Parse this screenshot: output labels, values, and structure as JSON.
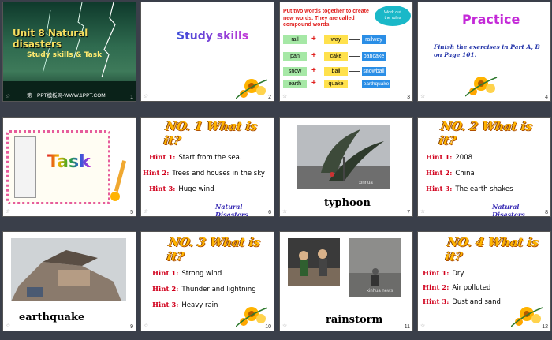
{
  "slides": [
    {
      "number": "1",
      "title": "Unit 8 Natural disasters",
      "subtitle": "Study skills & Task",
      "footer": "第一PPT模板网-WWW.1PPT.COM"
    },
    {
      "number": "2",
      "title": "Study skills"
    },
    {
      "number": "3",
      "instruction": "Put two words together to create new words. They are called compound words.",
      "bubble": "Work out the rules",
      "rows": [
        {
          "a": "rail",
          "b": "way",
          "result": "railway"
        },
        {
          "a": "pan",
          "b": "cake",
          "result": "pancake"
        },
        {
          "a": "snow",
          "b": "ball",
          "result": "snowball"
        },
        {
          "a": "earth",
          "b": "quake",
          "result": "earthquake"
        }
      ],
      "plus": "+",
      "arrow": "→"
    },
    {
      "number": "4",
      "title": "Practice",
      "body": "Finish the exercises in Part A, B on Page 101."
    },
    {
      "number": "5",
      "title": "Task"
    },
    {
      "number": "6",
      "title": "NO. 1 What is it?",
      "hints": [
        {
          "label": "Hint 1:",
          "text": "Start from the sea."
        },
        {
          "label": "Hint 2:",
          "text": "Trees and houses in the sky"
        },
        {
          "label": "Hint 3:",
          "text": "Huge wind"
        }
      ],
      "banner": "Natural Disasters"
    },
    {
      "number": "7",
      "caption": "typhoon",
      "watermark": "xinhua"
    },
    {
      "number": "8",
      "title": "NO. 2 What is it?",
      "hints": [
        {
          "label": "Hint 1:",
          "text": "2008"
        },
        {
          "label": "Hint 2:",
          "text": "China"
        },
        {
          "label": "Hint 3:",
          "text": "The earth shakes"
        }
      ],
      "banner": "Natural Disasters"
    },
    {
      "number": "9",
      "caption": "earthquake"
    },
    {
      "number": "10",
      "title": "NO. 3 What is it?",
      "hints": [
        {
          "label": "Hint 1:",
          "text": "Strong wind"
        },
        {
          "label": "Hint 2:",
          "text": "Thunder and lightning"
        },
        {
          "label": "Hint 3:",
          "text": "Heavy rain"
        }
      ]
    },
    {
      "number": "11",
      "caption": "rainstorm",
      "watermark": "xinhua news"
    },
    {
      "number": "12",
      "title": "NO. 4 What is it?",
      "hints": [
        {
          "label": "Hint 1:",
          "text": "Dry"
        },
        {
          "label": "Hint 2:",
          "text": "Air polluted"
        },
        {
          "label": "Hint 3:",
          "text": "Dust and sand"
        }
      ]
    }
  ],
  "colors": {
    "accent": "#ffb400",
    "hint_label": "#d1001c",
    "banner": "#3a2db5",
    "compound_green": "#7ddc7d",
    "compound_blue": "#1f7ad9"
  }
}
